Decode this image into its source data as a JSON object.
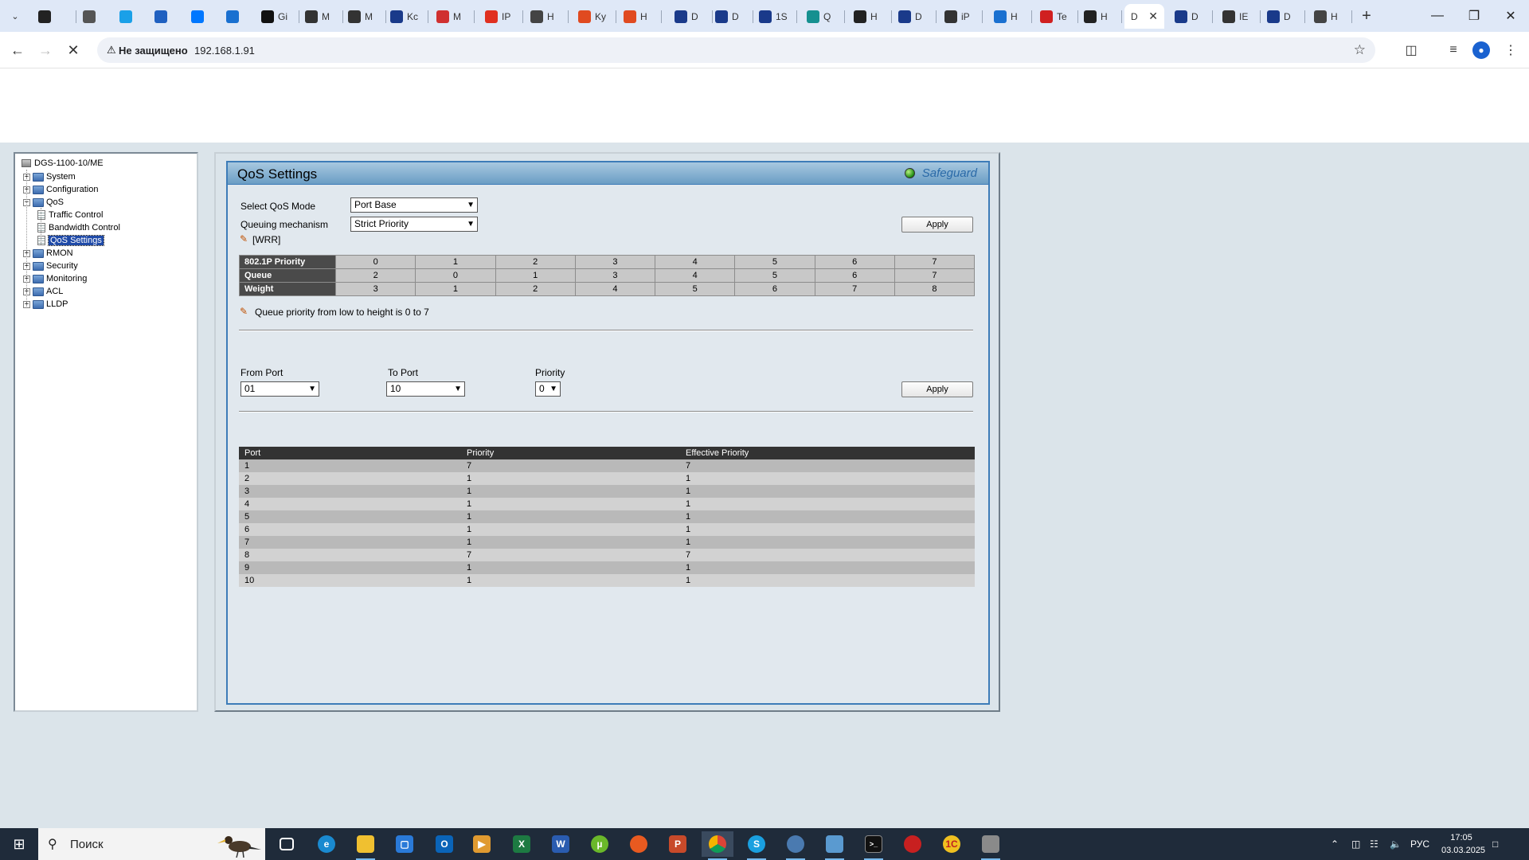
{
  "browser": {
    "tabs": [
      {
        "label": "",
        "icon": "app-icon",
        "color": "#222222"
      },
      {
        "label": "",
        "icon": "audio-icon",
        "color": "#555555"
      },
      {
        "label": "",
        "icon": "shield-icon",
        "color": "#1aa0e8"
      },
      {
        "label": "",
        "icon": "cloud-icon",
        "color": "#2060c0"
      },
      {
        "label": "",
        "icon": "vk-icon",
        "color": "#0077ff"
      },
      {
        "label": "",
        "icon": "s-icon",
        "color": "#1a70d0"
      },
      {
        "label": "Gi",
        "icon": "github-icon",
        "color": "#111111"
      },
      {
        "label": "M",
        "icon": "wikipedia-icon",
        "color": "#333333"
      },
      {
        "label": "M",
        "icon": "wikipedia-icon",
        "color": "#333333"
      },
      {
        "label": "Kc",
        "icon": "check-icon",
        "color": "#1a3a8a"
      },
      {
        "label": "M",
        "icon": "mail-icon",
        "color": "#d03030"
      },
      {
        "label": "IP",
        "icon": "ip-icon",
        "color": "#e03020"
      },
      {
        "label": "H",
        "icon": "globe-icon",
        "color": "#444444"
      },
      {
        "label": "Ky",
        "icon": "grid-icon",
        "color": "#e04a20"
      },
      {
        "label": "H",
        "icon": "grid-icon",
        "color": "#e04a20"
      },
      {
        "label": "D",
        "icon": "d-icon",
        "color": "#1a3a8a"
      },
      {
        "label": "D",
        "icon": "d-icon",
        "color": "#1a3a8a"
      },
      {
        "label": "1S",
        "icon": "d-icon",
        "color": "#1a3a8a"
      },
      {
        "label": "Q",
        "icon": "m-icon",
        "color": "#159090"
      },
      {
        "label": "H",
        "icon": "globe-icon",
        "color": "#222222"
      },
      {
        "label": "D",
        "icon": "d-icon",
        "color": "#1a3a8a"
      },
      {
        "label": "iP",
        "icon": "text-icon",
        "color": "#333333"
      },
      {
        "label": "H",
        "icon": "globe-icon",
        "color": "#1a70d0"
      },
      {
        "label": "Te",
        "icon": "grid-icon",
        "color": "#d02020"
      },
      {
        "label": "H",
        "icon": "globe-icon",
        "color": "#222222"
      },
      {
        "label": "D",
        "icon": "",
        "color": "#ffffff",
        "active": true
      },
      {
        "label": "D",
        "icon": "d-icon",
        "color": "#1a3a8a"
      },
      {
        "label": "IE",
        "icon": "wikipedia-icon",
        "color": "#333333"
      },
      {
        "label": "D",
        "icon": "d-icon",
        "color": "#1a3a8a"
      },
      {
        "label": "H",
        "icon": "globe-icon",
        "color": "#444444"
      }
    ],
    "security_label": "Не защищено",
    "url": "192.168.1.91"
  },
  "tree": {
    "root": "DGS-1100-10/ME",
    "items": [
      {
        "label": "System",
        "type": "folder",
        "expanded": false
      },
      {
        "label": "Configuration",
        "type": "folder",
        "expanded": false
      },
      {
        "label": "QoS",
        "type": "folder",
        "expanded": true
      },
      {
        "label": "Traffic Control",
        "type": "doc"
      },
      {
        "label": "Bandwidth Control",
        "type": "doc"
      },
      {
        "label": "QoS Settings",
        "type": "doc",
        "selected": true
      },
      {
        "label": "RMON",
        "type": "folder",
        "expanded": false
      },
      {
        "label": "Security",
        "type": "folder",
        "expanded": false
      },
      {
        "label": "Monitoring",
        "type": "folder",
        "expanded": false
      },
      {
        "label": "ACL",
        "type": "folder",
        "expanded": false
      },
      {
        "label": "LLDP",
        "type": "folder",
        "expanded": false
      }
    ]
  },
  "qos": {
    "title": "QoS Settings",
    "safeguard": "Safeguard",
    "mode_label": "Select QoS Mode",
    "mode_value": "Port Base",
    "queuing_label": "Queuing mechanism",
    "queuing_value": "Strict Priority",
    "apply_label": "Apply",
    "wrr_note": "[WRR]",
    "priority_table": {
      "rows": [
        {
          "header": "802.1P Priority",
          "values": [
            "0",
            "1",
            "2",
            "3",
            "4",
            "5",
            "6",
            "7"
          ]
        },
        {
          "header": "Queue",
          "values": [
            "2",
            "0",
            "1",
            "3",
            "4",
            "5",
            "6",
            "7"
          ]
        },
        {
          "header": "Weight",
          "values": [
            "3",
            "1",
            "2",
            "4",
            "5",
            "6",
            "7",
            "8"
          ]
        }
      ]
    },
    "queue_note": "Queue priority from low to height is 0 to 7",
    "from_port_label": "From Port",
    "from_port_value": "01",
    "to_port_label": "To Port",
    "to_port_value": "10",
    "priority_label": "Priority",
    "priority_value": "0",
    "port_table": {
      "headers": [
        "Port",
        "Priority",
        "Effective Priority"
      ],
      "rows": [
        [
          "1",
          "7",
          "7"
        ],
        [
          "2",
          "1",
          "1"
        ],
        [
          "3",
          "1",
          "1"
        ],
        [
          "4",
          "1",
          "1"
        ],
        [
          "5",
          "1",
          "1"
        ],
        [
          "6",
          "1",
          "1"
        ],
        [
          "7",
          "1",
          "1"
        ],
        [
          "8",
          "7",
          "7"
        ],
        [
          "9",
          "1",
          "1"
        ],
        [
          "10",
          "1",
          "1"
        ]
      ]
    }
  },
  "taskbar": {
    "search_placeholder": "Поиск",
    "language": "РУС",
    "time": "17:05",
    "date": "03.03.2025"
  }
}
